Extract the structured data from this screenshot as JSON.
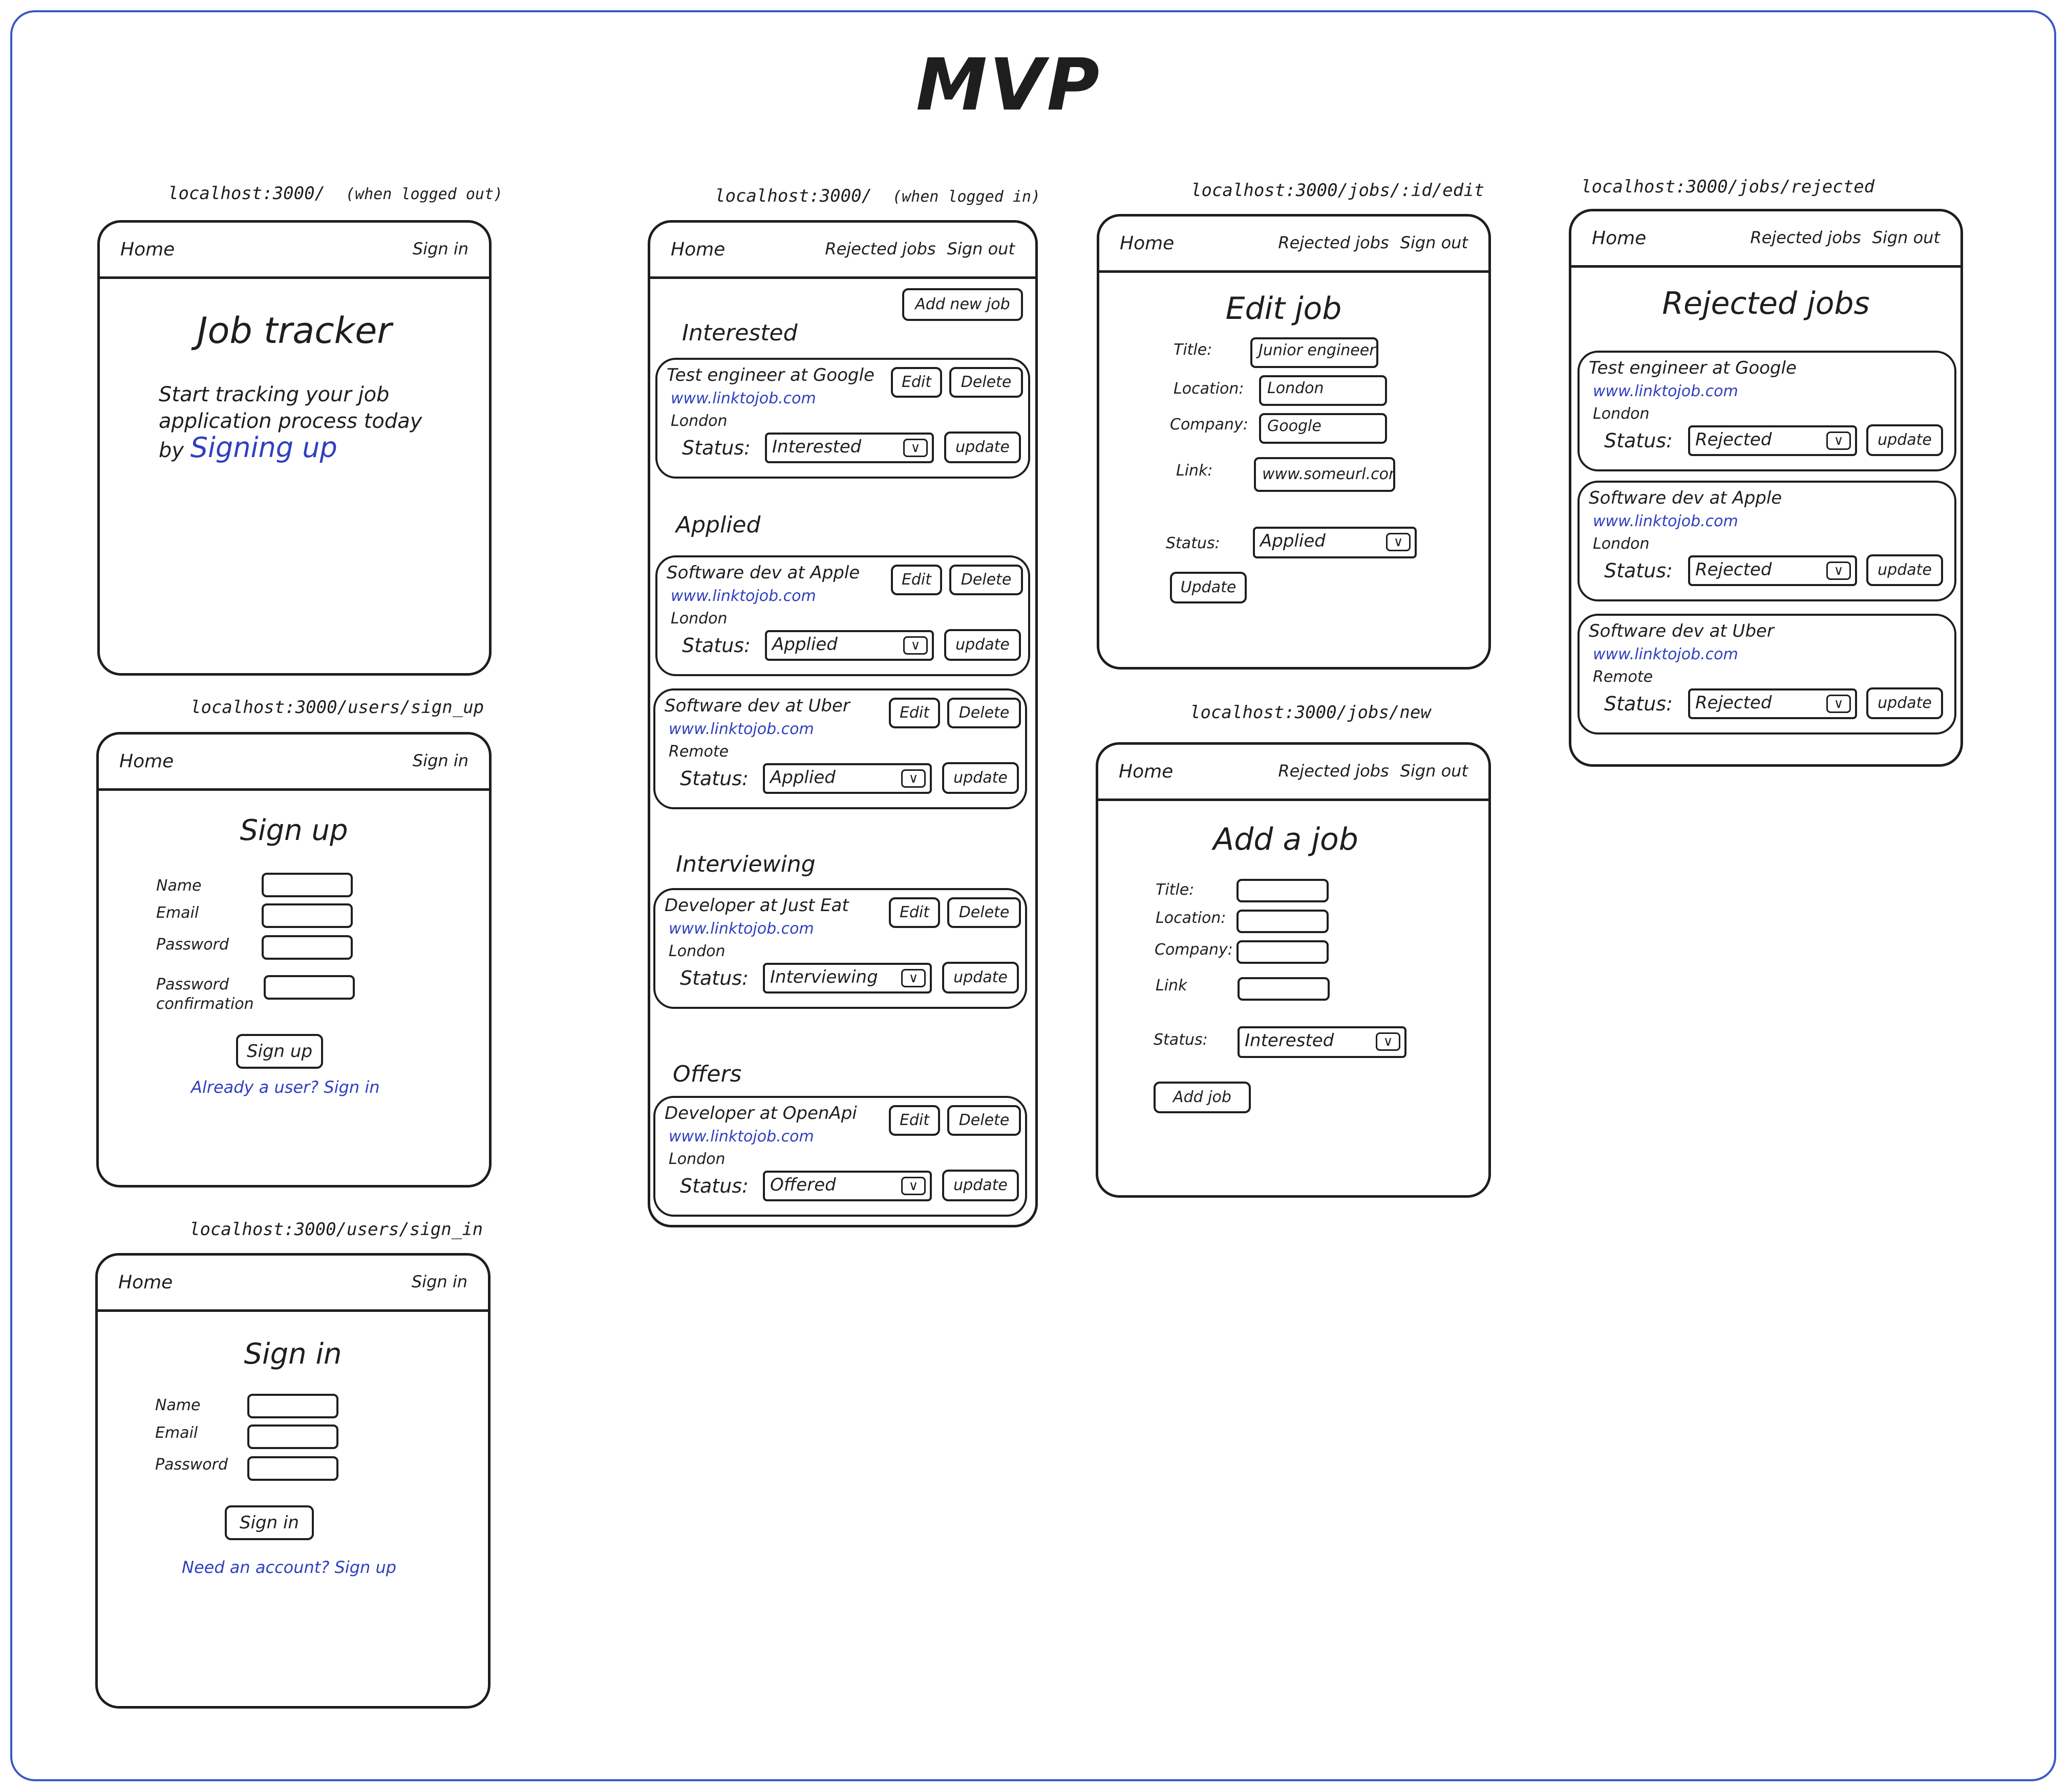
{
  "title": "MVP",
  "screens": {
    "home_out": {
      "url": "localhost:3000/",
      "note": "(when logged out)",
      "nav": {
        "home": "Home",
        "right": [
          "Sign in"
        ]
      },
      "heading": "Job tracker",
      "line1": "Start tracking your job",
      "line2": "application process today",
      "by": "by",
      "link": "Signing up"
    },
    "sign_up": {
      "url": "localhost:3000/users/sign_up",
      "nav": {
        "home": "Home",
        "right": [
          "Sign in"
        ]
      },
      "heading": "Sign up",
      "fields": [
        "Name",
        "Email",
        "Password",
        "Password",
        "confirmation"
      ],
      "button": "Sign up",
      "link": "Already a user? Sign in"
    },
    "sign_in": {
      "url": "localhost:3000/users/sign_in",
      "nav": {
        "home": "Home",
        "right": [
          "Sign in"
        ]
      },
      "heading": "Sign in",
      "fields": [
        "Name",
        "Email",
        "Password"
      ],
      "button": "Sign in",
      "link": "Need an account? Sign up"
    },
    "home_in": {
      "url": "localhost:3000/",
      "note": "(when logged in)",
      "nav": {
        "home": "Home",
        "right": [
          "Rejected jobs",
          "Sign out"
        ]
      },
      "add_button": "Add new job",
      "edit_label": "Edit",
      "delete_label": "Delete",
      "update_label": "update",
      "status_label": "Status:",
      "sections": [
        {
          "label": "Interested",
          "jobs": [
            {
              "title": "Test engineer at Google",
              "link": "www.linktojob.com",
              "location": "London",
              "status": "Interested"
            }
          ]
        },
        {
          "label": "Applied",
          "jobs": [
            {
              "title": "Software dev at Apple",
              "link": "www.linktojob.com",
              "location": "London",
              "status": "Applied"
            },
            {
              "title": "Software dev at Uber",
              "link": "www.linktojob.com",
              "location": "Remote",
              "status": "Applied"
            }
          ]
        },
        {
          "label": "Interviewing",
          "jobs": [
            {
              "title": "Developer at Just Eat",
              "link": "www.linktojob.com",
              "location": "London",
              "status": "Interviewing"
            }
          ]
        },
        {
          "label": "Offers",
          "jobs": [
            {
              "title": "Developer at OpenApi",
              "link": "www.linktojob.com",
              "location": "London",
              "status": "Offered"
            }
          ]
        }
      ]
    },
    "edit": {
      "url": "localhost:3000/jobs/:id/edit",
      "nav": {
        "home": "Home",
        "right": [
          "Rejected jobs",
          "Sign out"
        ]
      },
      "heading": "Edit job",
      "fields": [
        {
          "label": "Title:",
          "value": "Junior engineer"
        },
        {
          "label": "Location:",
          "value": "London"
        },
        {
          "label": "Company:",
          "value": "Google"
        },
        {
          "label": "Link:",
          "value": "www.someurl.com"
        }
      ],
      "status_label": "Status:",
      "status_value": "Applied",
      "button": "Update"
    },
    "new": {
      "url": "localhost:3000/jobs/new",
      "nav": {
        "home": "Home",
        "right": [
          "Rejected jobs",
          "Sign out"
        ]
      },
      "heading": "Add a job",
      "fields": [
        "Title:",
        "Location:",
        "Company:",
        "Link"
      ],
      "status_label": "Status:",
      "status_value": "Interested",
      "button": "Add job"
    },
    "rejected": {
      "url": "localhost:3000/jobs/rejected",
      "nav": {
        "home": "Home",
        "right": [
          "Rejected jobs",
          "Sign out"
        ]
      },
      "heading": "Rejected jobs",
      "status_label": "Status:",
      "update_label": "update",
      "jobs": [
        {
          "title": "Test engineer at Google",
          "link": "www.linktojob.com",
          "location": "London",
          "status": "Rejected"
        },
        {
          "title": "Software dev at Apple",
          "link": "www.linktojob.com",
          "location": "London",
          "status": "Rejected"
        },
        {
          "title": "Software dev at Uber",
          "link": "www.linktojob.com",
          "location": "Remote",
          "status": "Rejected"
        }
      ]
    }
  },
  "colors": {
    "frame": "#3a56c8",
    "link": "#2f3fbf",
    "ink": "#1e1e1e"
  }
}
